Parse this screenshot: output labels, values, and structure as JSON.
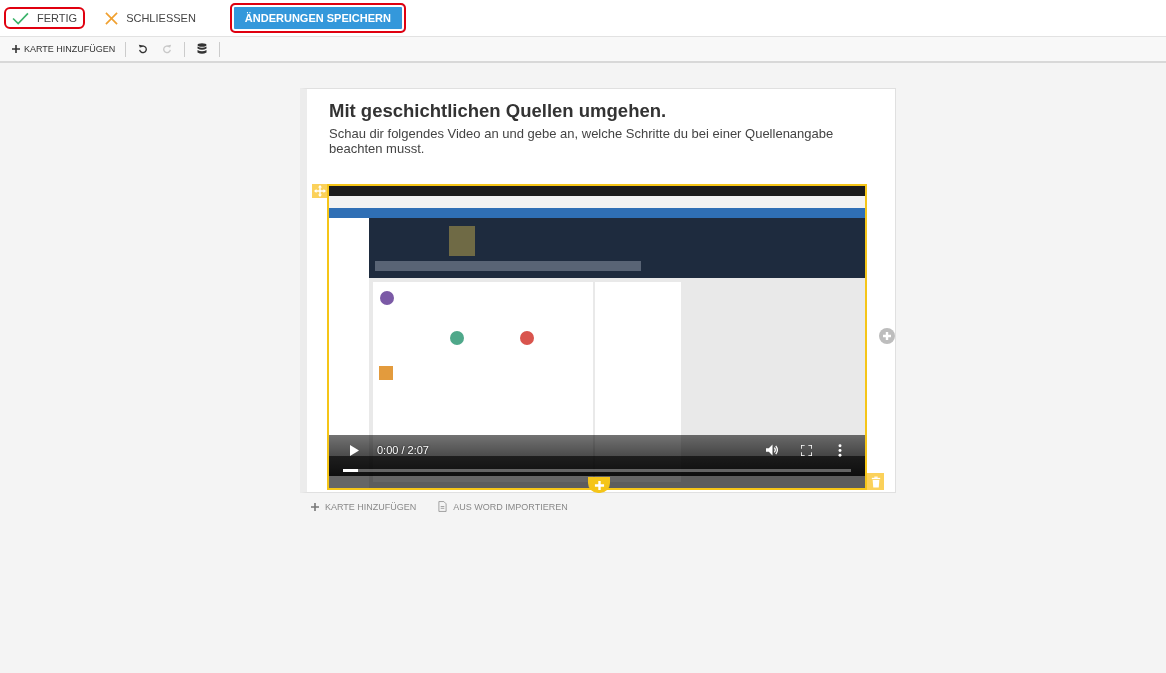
{
  "top_bar": {
    "buttons": [
      {
        "kind": "done",
        "label": "FERTIG",
        "highlighted": true
      },
      {
        "kind": "close",
        "label": "SCHLIESSEN",
        "highlighted": false
      },
      {
        "kind": "save",
        "label": "ÄNDERUNGEN SPEICHERN",
        "highlighted": true
      }
    ]
  },
  "toolbar": {
    "add_card": "KARTE HINZUFÜGEN",
    "undo": {
      "disabled": false
    },
    "redo": {
      "disabled": true
    }
  },
  "card": {
    "title": "Mit geschichtlichen Quellen umgehen.",
    "text": "Schau dir folgendes Video an und gebe an, welche Schritte du bei einer Quellenangabe beachten musst.",
    "video": {
      "kind": "picture",
      "time": "0:00 / 2:07",
      "level": 0.03
    }
  },
  "bottom_actions": [
    {
      "kind": "add",
      "label": "KARTE HINZUFÜGEN"
    },
    {
      "kind": "import",
      "label": "AUS WORD IMPORTIEREN"
    }
  ]
}
